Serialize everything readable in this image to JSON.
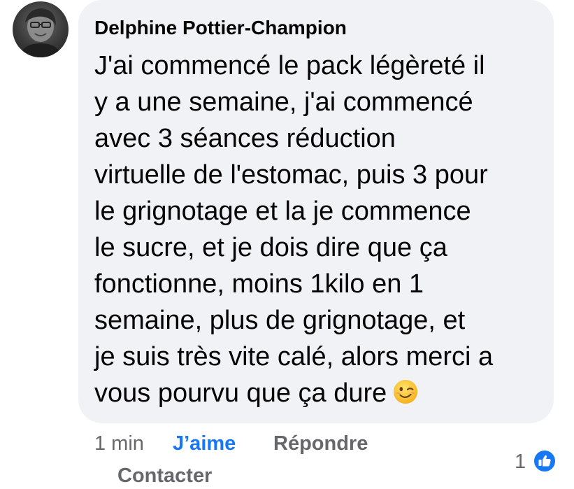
{
  "comment": {
    "author": "Delphine Pottier-Champion",
    "lines": [
      "J'ai commencé le pack légèreté il",
      "y a une semaine,  j'ai commencé",
      "avec 3 séances réduction",
      "virtuelle de l'estomac, puis 3 pour",
      "le grignotage et la je commence",
      "le sucre, et je dois dire que ça",
      "fonctionne, moins 1kilo en 1",
      "semaine,  plus de grignotage, et",
      "je suis très vite calé, alors merci a",
      "vous pourvu que ça dure"
    ],
    "emoji": "winking-face-emoji"
  },
  "actions": {
    "time": "1 min",
    "like_label": "J’aime",
    "reply_label": "Répondre",
    "contact_label": "Contacter"
  },
  "reactions": {
    "count": "1",
    "icon": "like-thumbs-up-icon"
  },
  "colors": {
    "bubble": "#f0f2f5",
    "text": "#050505",
    "muted": "#65676b",
    "accent": "#1877f2"
  }
}
